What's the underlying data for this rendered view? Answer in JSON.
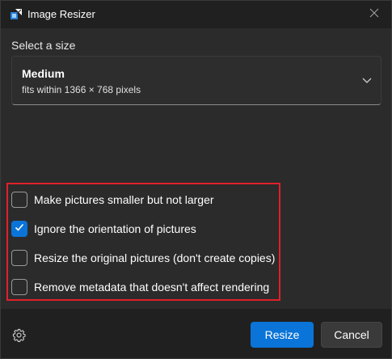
{
  "window": {
    "title": "Image Resizer",
    "app_icon": "image-resizer-icon",
    "close_icon": "close-icon"
  },
  "size_section": {
    "label": "Select a size",
    "selected_name": "Medium",
    "selected_desc": "fits within 1366 × 768 pixels",
    "dropdown_icon": "chevron-down-icon"
  },
  "options": [
    {
      "label": "Make pictures smaller but not larger",
      "checked": false
    },
    {
      "label": "Ignore the orientation of pictures",
      "checked": true
    },
    {
      "label": "Resize the original pictures (don't create copies)",
      "checked": false
    },
    {
      "label": "Remove metadata that doesn't affect rendering",
      "checked": false
    }
  ],
  "footer": {
    "settings_icon": "gear-icon",
    "resize_label": "Resize",
    "cancel_label": "Cancel"
  },
  "colors": {
    "accent": "#0a74d8",
    "highlight_border": "#e0202a",
    "background": "#2b2b2b"
  }
}
